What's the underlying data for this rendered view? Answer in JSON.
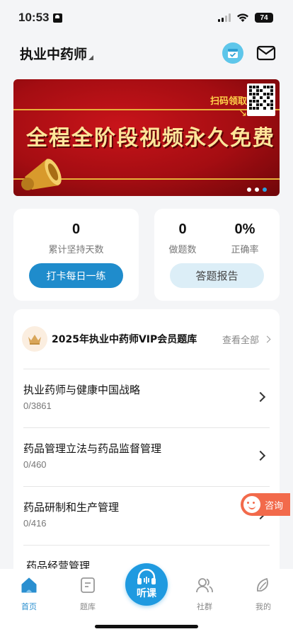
{
  "status_bar": {
    "time": "10:53",
    "battery": "74"
  },
  "header": {
    "subject": "执业中药师"
  },
  "banner": {
    "title": "全程全阶段视频永久免费",
    "scan_label": "扫码领取",
    "slide_count": 3,
    "active_slide": 3
  },
  "stats": {
    "streak_value": "0",
    "streak_label": "累计坚持天数",
    "checkin_button": "打卡每日一练",
    "done_value": "0",
    "done_label": "做题数",
    "accuracy_value": "0%",
    "accuracy_label": "正确率",
    "report_button": "答题报告"
  },
  "question_bank": {
    "title": "2025年执业中药师VIP会员题库",
    "view_all": "查看全部",
    "rows": [
      {
        "name": "执业药师与健康中国战略",
        "count": "0/3861"
      },
      {
        "name": "药品管理立法与药品监督管理",
        "count": "0/460"
      },
      {
        "name": "药品研制和生产管理",
        "count": "0/416"
      },
      {
        "name": "药品经营管理",
        "count": ""
      }
    ]
  },
  "consult": {
    "label": "咨询"
  },
  "tabbar": {
    "home": "首页",
    "bank": "题库",
    "listen": "听课",
    "community": "社群",
    "mine": "我的"
  },
  "colors": {
    "accent": "#1f8ccc",
    "consult": "#f26a4b",
    "banner_red": "#b3111a"
  }
}
